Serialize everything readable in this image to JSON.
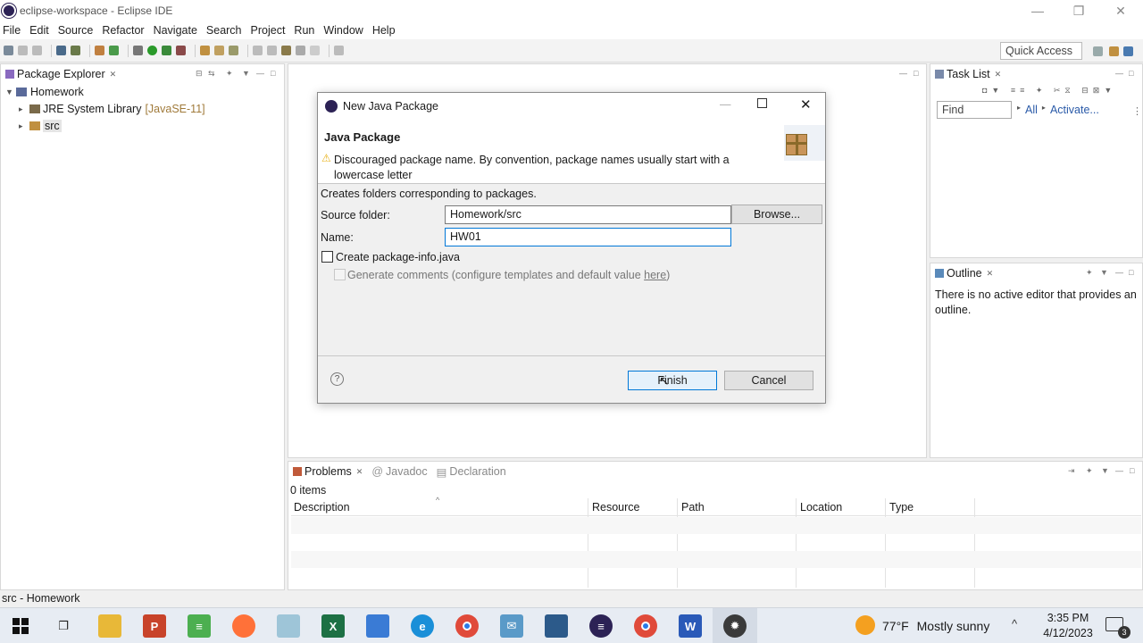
{
  "window": {
    "title": "eclipse-workspace - Eclipse IDE"
  },
  "menu": [
    "File",
    "Edit",
    "Source",
    "Refactor",
    "Navigate",
    "Search",
    "Project",
    "Run",
    "Window",
    "Help"
  ],
  "toolbar": {
    "quick_access": "Quick Access"
  },
  "package_explorer": {
    "tab": "Package Explorer",
    "project": "Homework",
    "items": [
      {
        "label": "JRE System Library",
        "suffix": "[JavaSE-11]"
      },
      {
        "label": "src"
      }
    ]
  },
  "task_list": {
    "tab": "Task List",
    "find_placeholder": "Find",
    "all_label": "All",
    "activate_label": "Activate..."
  },
  "outline": {
    "tab": "Outline",
    "message": "There is no active editor that provides an outline."
  },
  "dialog": {
    "title": "New Java Package",
    "heading": "Java Package",
    "warning": "Discouraged package name. By convention, package names usually start with a lowercase letter",
    "description": "Creates folders corresponding to packages.",
    "source_folder_label": "Source folder:",
    "source_folder_value": "Homework/src",
    "browse_label": "Browse...",
    "name_label": "Name:",
    "name_value": "HW01",
    "create_info_label": "Create package-info.java",
    "generate_comments_label": "Generate comments (configure templates and default value ",
    "here_link": "here",
    "generate_comments_close": ")",
    "finish_label": "Finish",
    "cancel_label": "Cancel",
    "help_icon": "?"
  },
  "problems": {
    "tabs": [
      "Problems",
      "Javadoc",
      "Declaration"
    ],
    "count": "0 items",
    "columns": [
      "Description",
      "Resource",
      "Path",
      "Location",
      "Type"
    ]
  },
  "status_bar": {
    "text": "src - Homework"
  },
  "taskbar": {
    "weather_temp": "77°F",
    "weather_desc": "Mostly sunny",
    "time": "3:35 PM",
    "date": "4/12/2023",
    "notifications": "3",
    "apps": [
      "start-icon",
      "task-view-icon",
      "file-explorer-icon",
      "powerpoint-icon",
      "notepad-plus-icon",
      "firefox-icon",
      "app-icon",
      "excel-icon",
      "store-icon",
      "edge-icon",
      "chrome-icon",
      "mail-icon",
      "visual-studio-icon",
      "eclipse-icon",
      "chrome-profile-icon",
      "word-icon",
      "eclipse-active-icon"
    ]
  },
  "colors": {
    "accent": "#0078d7",
    "warning": "#e8b21a",
    "decoration": "#8a6a2a"
  }
}
